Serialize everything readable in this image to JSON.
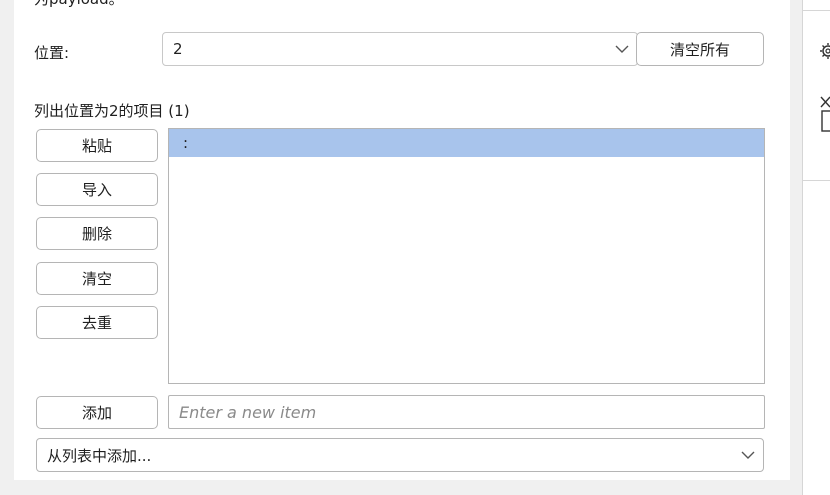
{
  "top_cut_text": "为payload。",
  "position": {
    "label": "位置:",
    "value": "2",
    "clear_all_label": "清空所有"
  },
  "list_header": "列出位置为2的项目 (1)",
  "side_buttons": [
    {
      "label": "粘贴"
    },
    {
      "label": "导入"
    },
    {
      "label": "删除"
    },
    {
      "label": "清空"
    },
    {
      "label": "去重"
    }
  ],
  "list": {
    "items": [
      ":"
    ]
  },
  "add": {
    "button_label": "添加",
    "input_placeholder": "Enter a new item",
    "input_value": ""
  },
  "add_from_list": {
    "value": "从列表中添加..."
  },
  "right_rail": {
    "icons": [
      "gear-icon",
      "close-box-icon"
    ]
  },
  "colors": {
    "selection": "#a8c4ec",
    "border": "#b5b5b5",
    "panel_bg": "#ffffff",
    "outer_bg": "#f0f0f0"
  }
}
